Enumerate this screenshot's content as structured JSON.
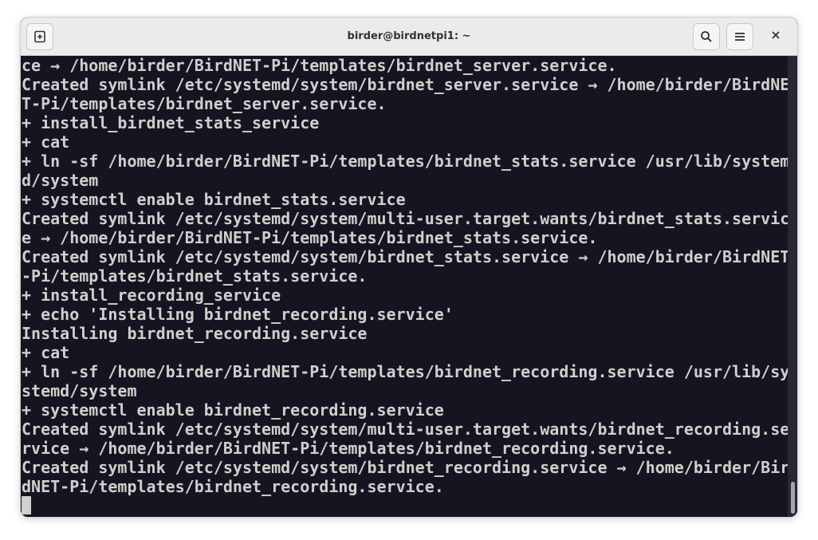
{
  "window": {
    "title": "birder@birdnetpi1: ~"
  },
  "icons": {
    "new_tab": "new-tab-icon",
    "search": "search-icon",
    "menu": "hamburger-menu-icon",
    "close": "close-icon"
  },
  "terminal": {
    "lines": [
      "ce → /home/birder/BirdNET-Pi/templates/birdnet_server.service.",
      "Created symlink /etc/systemd/system/birdnet_server.service → /home/birder/BirdNE",
      "T-Pi/templates/birdnet_server.service.",
      "+ install_birdnet_stats_service",
      "+ cat",
      "+ ln -sf /home/birder/BirdNET-Pi/templates/birdnet_stats.service /usr/lib/system",
      "d/system",
      "+ systemctl enable birdnet_stats.service",
      "Created symlink /etc/systemd/system/multi-user.target.wants/birdnet_stats.servic",
      "e → /home/birder/BirdNET-Pi/templates/birdnet_stats.service.",
      "Created symlink /etc/systemd/system/birdnet_stats.service → /home/birder/BirdNET",
      "-Pi/templates/birdnet_stats.service.",
      "+ install_recording_service",
      "+ echo 'Installing birdnet_recording.service'",
      "Installing birdnet_recording.service",
      "+ cat",
      "+ ln -sf /home/birder/BirdNET-Pi/templates/birdnet_recording.service /usr/lib/sy",
      "stemd/system",
      "+ systemctl enable birdnet_recording.service",
      "Created symlink /etc/systemd/system/multi-user.target.wants/birdnet_recording.se",
      "rvice → /home/birder/BirdNET-Pi/templates/birdnet_recording.service.",
      "Created symlink /etc/systemd/system/birdnet_recording.service → /home/birder/Bir",
      "dNET-Pi/templates/birdnet_recording.service."
    ]
  },
  "colors": {
    "terminal_bg": "#171421",
    "terminal_fg": "#d0cfcc",
    "titlebar_bg": "#ebebeb"
  }
}
